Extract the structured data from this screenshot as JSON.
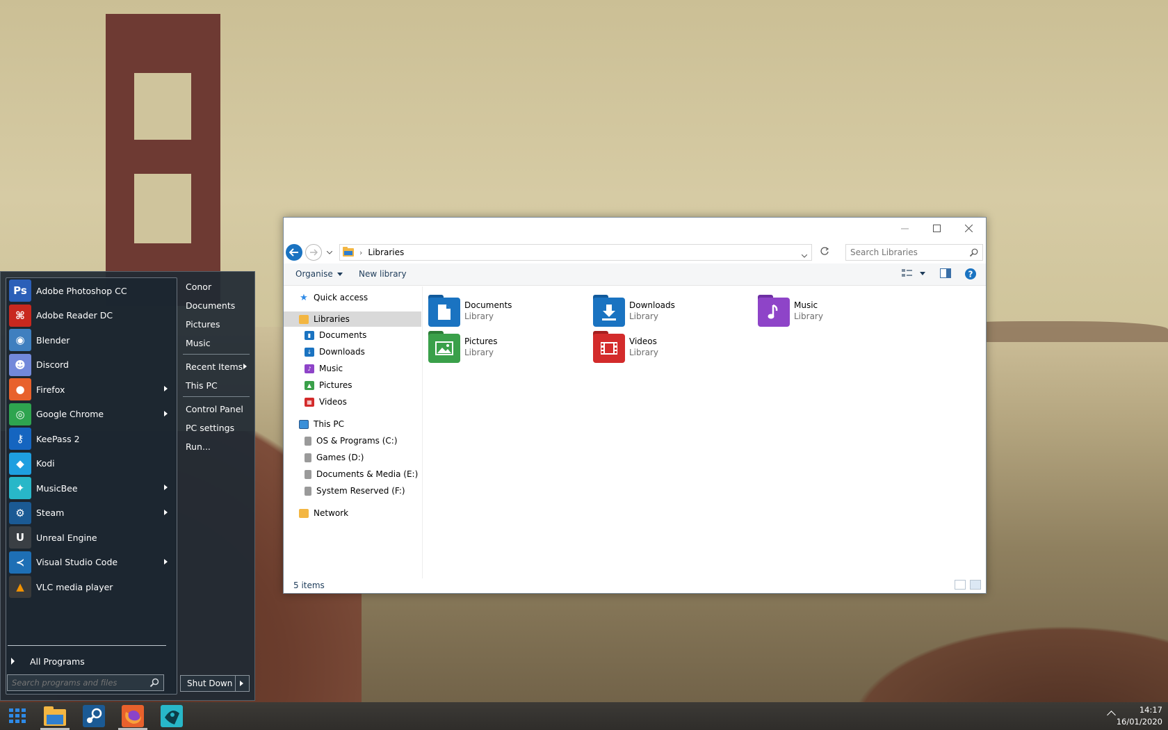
{
  "start_menu": {
    "programs": [
      {
        "label": "Adobe Photoshop CC",
        "icon": "photoshop-icon",
        "icon_text": "Ps",
        "color": "#2b5fb8",
        "submenu": false
      },
      {
        "label": "Adobe Reader DC",
        "icon": "acrobat-icon",
        "icon_text": "",
        "color": "#c8281f",
        "submenu": false
      },
      {
        "label": "Blender",
        "icon": "blender-icon",
        "icon_text": "",
        "color": "#3f7fbf",
        "submenu": false
      },
      {
        "label": "Discord",
        "icon": "discord-icon",
        "icon_text": "",
        "color": "#7289da",
        "submenu": false
      },
      {
        "label": "Firefox",
        "icon": "firefox-icon",
        "icon_text": "",
        "color": "#e8612c",
        "submenu": true
      },
      {
        "label": "Google Chrome",
        "icon": "chrome-icon",
        "icon_text": "",
        "color": "#2ea44f",
        "submenu": true
      },
      {
        "label": "KeePass 2",
        "icon": "keepass-icon",
        "icon_text": "",
        "color": "#1565c0",
        "submenu": false
      },
      {
        "label": "Kodi",
        "icon": "kodi-icon",
        "icon_text": "",
        "color": "#1e9fe0",
        "submenu": false
      },
      {
        "label": "MusicBee",
        "icon": "musicbee-icon",
        "icon_text": "",
        "color": "#28b7c8",
        "submenu": true
      },
      {
        "label": "Steam",
        "icon": "steam-icon",
        "icon_text": "",
        "color": "#1b5a94",
        "submenu": true
      },
      {
        "label": "Unreal Engine",
        "icon": "unreal-icon",
        "icon_text": "U",
        "color": "#3a3f44",
        "submenu": false
      },
      {
        "label": "Visual Studio Code",
        "icon": "vscode-icon",
        "icon_text": "",
        "color": "#1e6fb5",
        "submenu": true
      },
      {
        "label": "VLC media player",
        "icon": "vlc-icon",
        "icon_text": "",
        "color": "#3a3a3a",
        "submenu": false
      }
    ],
    "all_programs": "All Programs",
    "search_placeholder": "Search programs and files",
    "places": {
      "user": "Conor",
      "documents": "Documents",
      "pictures": "Pictures",
      "music": "Music",
      "recent_items": "Recent Items",
      "this_pc": "This PC",
      "control_panel": "Control Panel",
      "pc_settings": "PC settings",
      "run": "Run..."
    },
    "shutdown": "Shut Down"
  },
  "explorer": {
    "breadcrumb": "Libraries",
    "search_placeholder": "Search Libraries",
    "commands": {
      "organise": "Organise",
      "new_library": "New library"
    },
    "nav": {
      "quick_access": "Quick access",
      "libraries": "Libraries",
      "lib_items": [
        "Documents",
        "Downloads",
        "Music",
        "Pictures",
        "Videos"
      ],
      "this_pc": "This PC",
      "drives": [
        "OS & Programs (C:)",
        "Games (D:)",
        "Documents & Media (E:)",
        "System Reserved (F:)"
      ],
      "network": "Network"
    },
    "libraries": [
      {
        "name": "Documents",
        "sub": "Library",
        "color": "#1a73c1",
        "icon": "document-icon"
      },
      {
        "name": "Downloads",
        "sub": "Library",
        "color": "#1a73c1",
        "icon": "download-icon"
      },
      {
        "name": "Music",
        "sub": "Library",
        "color": "#8e44c8",
        "icon": "music-note-icon"
      },
      {
        "name": "Pictures",
        "sub": "Library",
        "color": "#3aa04a",
        "icon": "picture-icon"
      },
      {
        "name": "Videos",
        "sub": "Library",
        "color": "#d32b2b",
        "icon": "film-icon"
      }
    ],
    "status": "5 items"
  },
  "clock": {
    "time": "14:17",
    "date": "16/01/2020"
  },
  "colors": {
    "accent": "#1a73c1",
    "start_bg": "#202a34"
  }
}
